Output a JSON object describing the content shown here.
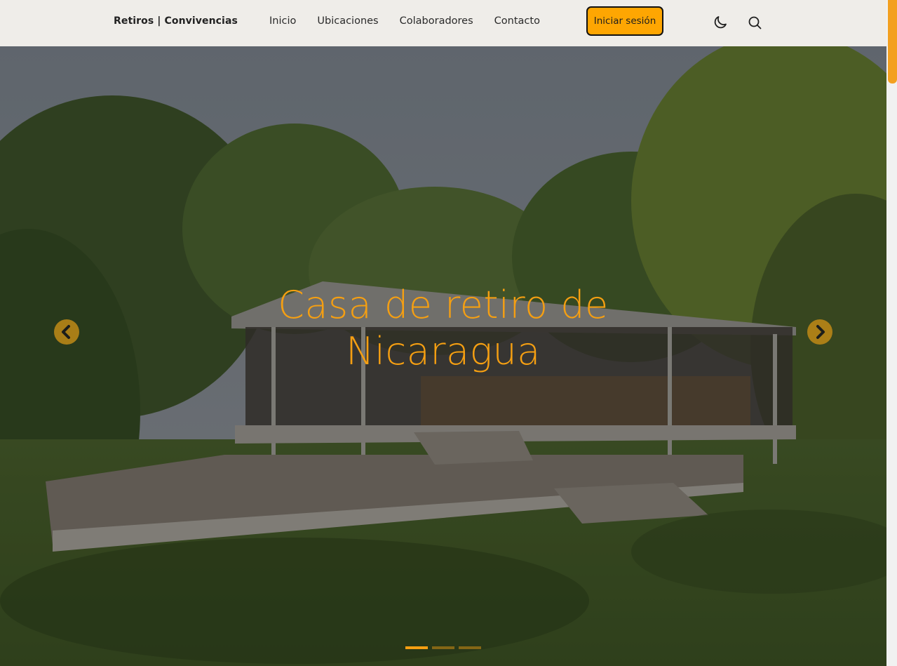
{
  "header": {
    "brand": "Retiros | Convivencias",
    "nav": [
      {
        "label": "Inicio"
      },
      {
        "label": "Ubicaciones"
      },
      {
        "label": "Colaboradores"
      },
      {
        "label": "Contacto"
      }
    ],
    "login_label": "Iniciar sesión",
    "icons": {
      "theme": "moon-icon",
      "search": "search-icon"
    }
  },
  "hero": {
    "title": "Casa de retiro de Nicaragua",
    "indicators": [
      {
        "active": true
      },
      {
        "active": false
      },
      {
        "active": false
      }
    ],
    "icons": {
      "prev": "chevron-left-icon",
      "next": "chevron-right-icon"
    }
  },
  "colors": {
    "accent": "#fea602",
    "title": "#f59f12",
    "header_bg": "#efede9"
  }
}
